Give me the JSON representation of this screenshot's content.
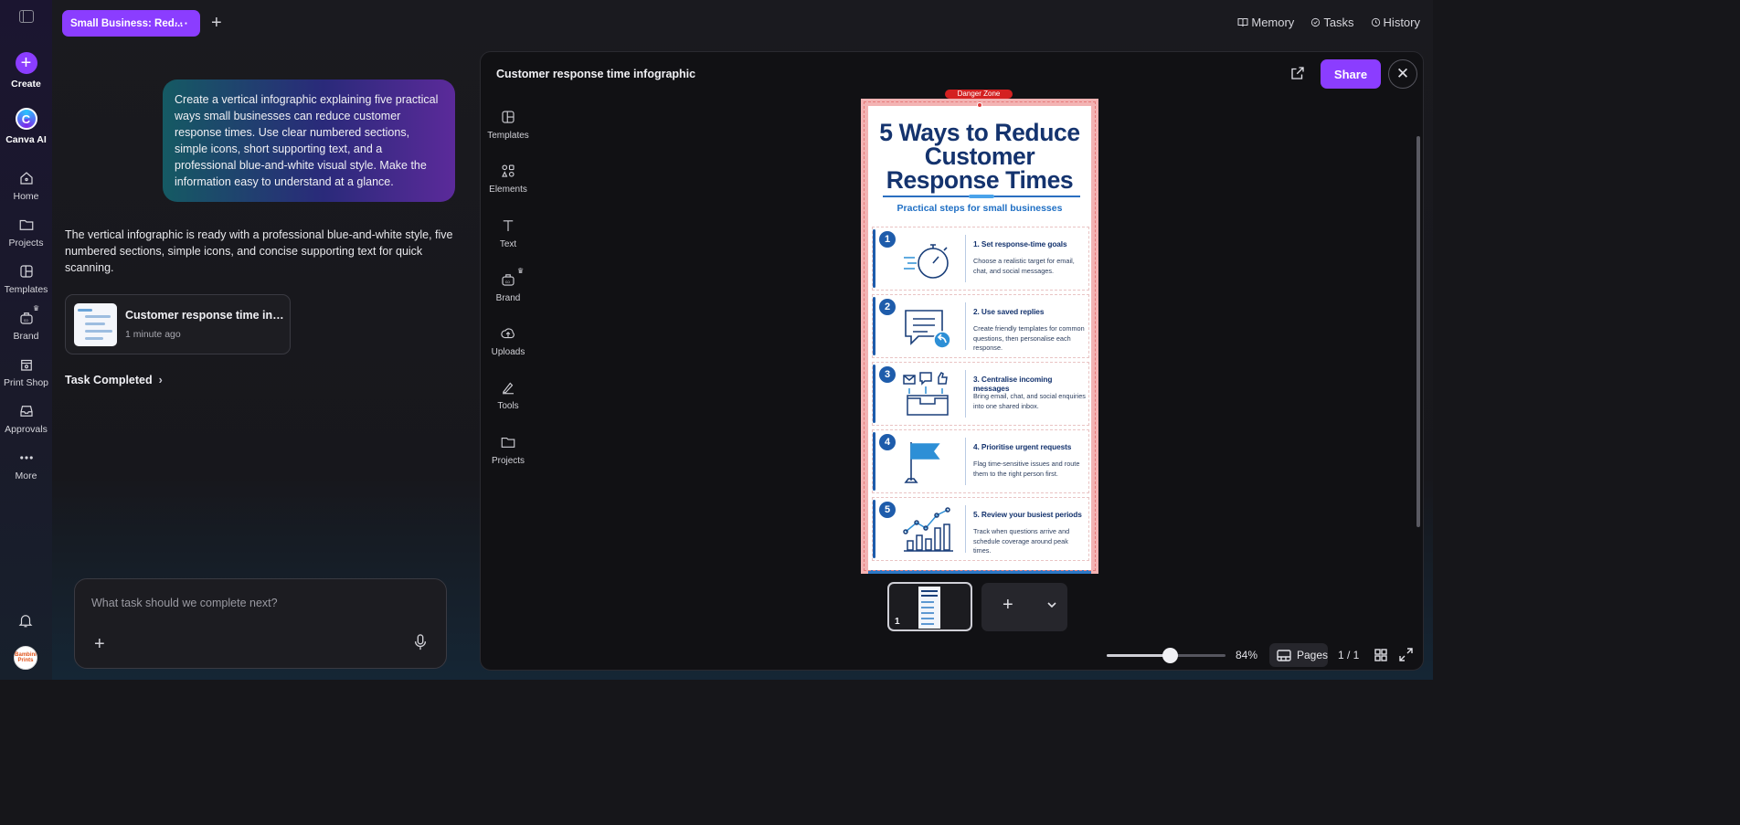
{
  "rail": {
    "create": "Create",
    "canva_ai": "Canva AI",
    "items": [
      {
        "label": "Home",
        "icon": "home-icon"
      },
      {
        "label": "Projects",
        "icon": "folder-icon"
      },
      {
        "label": "Templates",
        "icon": "templates-icon"
      },
      {
        "label": "Brand",
        "icon": "brand-icon"
      },
      {
        "label": "Print Shop",
        "icon": "print-shop-icon"
      },
      {
        "label": "Approvals",
        "icon": "approvals-icon"
      },
      {
        "label": "More",
        "icon": "more-icon"
      }
    ],
    "avatar_text": "Bambini Prints"
  },
  "topbar": {
    "tab_label": "Small Business: Red...",
    "tab_menu": "···",
    "add_tab": "+",
    "memory": "Memory",
    "tasks": "Tasks",
    "history": "History"
  },
  "chat": {
    "user_message": "Create a vertical infographic explaining five practical ways small businesses can reduce customer response times. Use clear numbered sections, simple icons, short supporting text, and a professional blue-and-white visual style. Make the information easy to understand at a glance.",
    "assistant_message": "The vertical infographic is ready with a professional blue-and-white style, five numbered sections, simple icons, and concise supporting text for quick scanning.",
    "result_title": "Customer response time info...",
    "result_time": "1 minute ago",
    "task_status": "Task Completed",
    "composer_placeholder": "What task should we complete next?",
    "composer_value": ""
  },
  "editor": {
    "title": "Customer response time infographic",
    "share": "Share",
    "close": "✕",
    "tools": [
      {
        "label": "Templates",
        "icon": "templates-icon"
      },
      {
        "label": "Elements",
        "icon": "elements-icon"
      },
      {
        "label": "Text",
        "icon": "text-icon"
      },
      {
        "label": "Brand",
        "icon": "brand-icon"
      },
      {
        "label": "Uploads",
        "icon": "uploads-icon"
      },
      {
        "label": "Tools",
        "icon": "tools-icon"
      },
      {
        "label": "Projects",
        "icon": "folder-icon"
      }
    ],
    "danger_zone": "Danger Zone"
  },
  "infographic": {
    "title_line1": "5 Ways to Reduce",
    "title_line2": "Customer",
    "title_line3": "Response Times",
    "subtitle": "Practical steps for small businesses",
    "steps": [
      {
        "num": "1",
        "head": "1. Set response-time goals",
        "body": "Choose a realistic target for email, chat, and social messages."
      },
      {
        "num": "2",
        "head": "2. Use saved replies",
        "body": "Create friendly templates for common questions, then personalise each response."
      },
      {
        "num": "3",
        "head": "3. Centralise incoming messages",
        "body": "Bring email, chat, and social enquiries into one shared inbox."
      },
      {
        "num": "4",
        "head": "4. Prioritise urgent requests",
        "body": "Flag time-sensitive issues and route them to the right person first."
      },
      {
        "num": "5",
        "head": "5. Review your busiest periods",
        "body": "Track when questions arrive and schedule coverage around peak times."
      }
    ]
  },
  "footer": {
    "page_thumb_number": "1",
    "zoom": "84%",
    "zoom_fraction": 0.55,
    "pages": "Pages",
    "page_count": "1 / 1"
  },
  "colors": {
    "accent": "#8b3dff",
    "infographic_navy": "#14336e",
    "infographic_blue": "#1e5cab"
  }
}
